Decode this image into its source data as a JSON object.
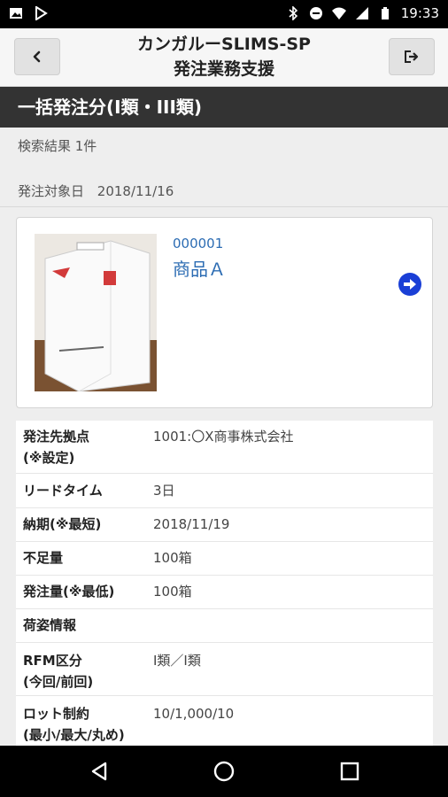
{
  "status_bar": {
    "time": "19:33",
    "left_icons": [
      "image-icon",
      "play-store-icon"
    ],
    "right_icons": [
      "bluetooth-icon",
      "do-not-disturb-icon",
      "wifi-icon",
      "signal-icon",
      "battery-icon"
    ]
  },
  "header": {
    "title_line1": "カンガルーSLIMS-SP",
    "title_line2": "発注業務支援",
    "back_icon": "chevron-left-icon",
    "logout_icon": "logout-icon"
  },
  "section_title": "一括発注分(I類・III類)",
  "search_result": "検索結果 1件",
  "order_date_label": "発注対象日",
  "order_date": "2018/11/16",
  "product": {
    "code": "000001",
    "name": "商品Ａ",
    "image_icon": "product-box-image",
    "arrow_icon": "arrow-right-circle-icon"
  },
  "details": [
    {
      "label_line1": "発注先拠点",
      "label_line2": "(※設定)",
      "value": "1001:〇X商事株式会社"
    },
    {
      "label_line1": "リードタイム",
      "label_line2": "",
      "value": "3日"
    },
    {
      "label_line1": "納期(※最短)",
      "label_line2": "",
      "value": "2018/11/19"
    },
    {
      "label_line1": "不足量",
      "label_line2": "",
      "value": "100箱"
    },
    {
      "label_line1": "発注量(※最低)",
      "label_line2": "",
      "value": "100箱"
    },
    {
      "label_line1": "荷姿情報",
      "label_line2": "",
      "value": ""
    },
    {
      "label_line1": "RFM区分",
      "label_line2": "(今回/前回)",
      "value": "I類／I類"
    },
    {
      "label_line1": "ロット制約",
      "label_line2": "(最小/最大/丸め)",
      "value": "10/1,000/10"
    }
  ],
  "nav": [
    "back-nav-icon",
    "home-nav-icon",
    "recents-nav-icon"
  ],
  "colors": {
    "accent_blue": "#2c6cb3",
    "arrow_blue": "#1a3fd6",
    "section_bg": "#333333"
  }
}
